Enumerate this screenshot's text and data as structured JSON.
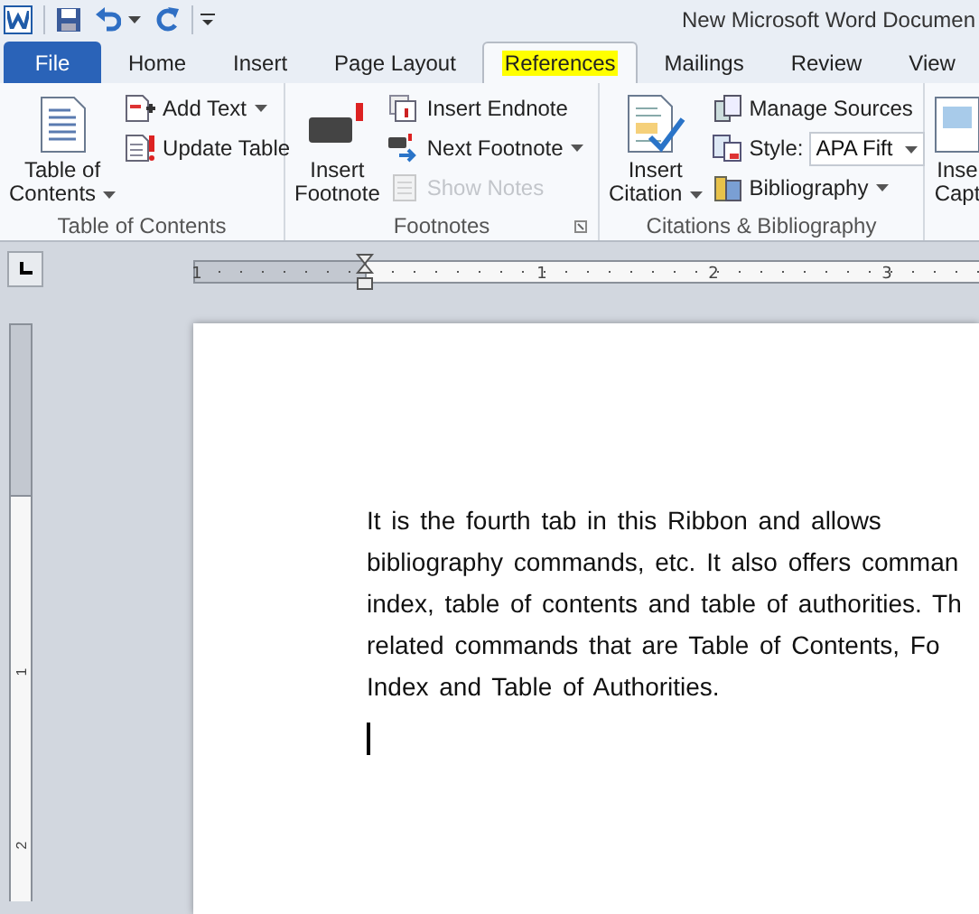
{
  "window": {
    "title": "New Microsoft Word Documen"
  },
  "tabs": [
    {
      "label": "File",
      "kind": "file",
      "selected": false,
      "highlighted": false
    },
    {
      "label": "Home",
      "kind": "tab",
      "selected": false,
      "highlighted": false
    },
    {
      "label": "Insert",
      "kind": "tab",
      "selected": false,
      "highlighted": false
    },
    {
      "label": "Page Layout",
      "kind": "tab",
      "selected": false,
      "highlighted": false
    },
    {
      "label": "References",
      "kind": "tab",
      "selected": true,
      "highlighted": true
    },
    {
      "label": "Mailings",
      "kind": "tab",
      "selected": false,
      "highlighted": false
    },
    {
      "label": "Review",
      "kind": "tab",
      "selected": false,
      "highlighted": false
    },
    {
      "label": "View",
      "kind": "tab",
      "selected": false,
      "highlighted": false
    }
  ],
  "ribbon": {
    "groups": [
      {
        "label": "Table of Contents",
        "launcher": false,
        "large": {
          "lines": [
            "Table of",
            "Contents"
          ],
          "dropdown": true
        },
        "small": [
          {
            "kind": "button",
            "label": "Add Text",
            "dropdown": true,
            "disabled": false
          },
          {
            "kind": "button",
            "label": "Update Table",
            "dropdown": false,
            "disabled": false
          }
        ]
      },
      {
        "label": "Footnotes",
        "launcher": true,
        "large": {
          "lines": [
            "Insert",
            "Footnote"
          ],
          "dropdown": false
        },
        "small": [
          {
            "kind": "button",
            "label": "Insert Endnote",
            "dropdown": false,
            "disabled": false
          },
          {
            "kind": "button",
            "label": "Next Footnote",
            "dropdown": true,
            "disabled": false
          },
          {
            "kind": "button",
            "label": "Show Notes",
            "dropdown": false,
            "disabled": true
          }
        ]
      },
      {
        "label": "Citations & Bibliography",
        "launcher": false,
        "large": {
          "lines": [
            "Insert",
            "Citation"
          ],
          "dropdown": true
        },
        "small": [
          {
            "kind": "button",
            "label": "Manage Sources",
            "dropdown": false,
            "disabled": false
          },
          {
            "kind": "combo",
            "label": "Style:",
            "value": "APA Fift",
            "dropdown": true,
            "disabled": false
          },
          {
            "kind": "button",
            "label": "Bibliography",
            "dropdown": true,
            "disabled": false
          }
        ]
      },
      {
        "launcher": false,
        "large": {
          "lines": [
            "Inse",
            "Capt"
          ],
          "dropdown": false
        }
      }
    ]
  },
  "ruler": {
    "numbers": [
      "1",
      "1",
      "2",
      "3"
    ]
  },
  "vertical_ruler": {
    "numbers": [
      "1",
      "2"
    ]
  },
  "document": {
    "lines": [
      "It is the fourth tab in this Ribbon and allows",
      "bibliography commands, etc. It also offers comman",
      "index, table of contents and table of authorities. Th",
      "related commands that are Table of Contents, Fo",
      "Index and Table of Authorities."
    ]
  }
}
